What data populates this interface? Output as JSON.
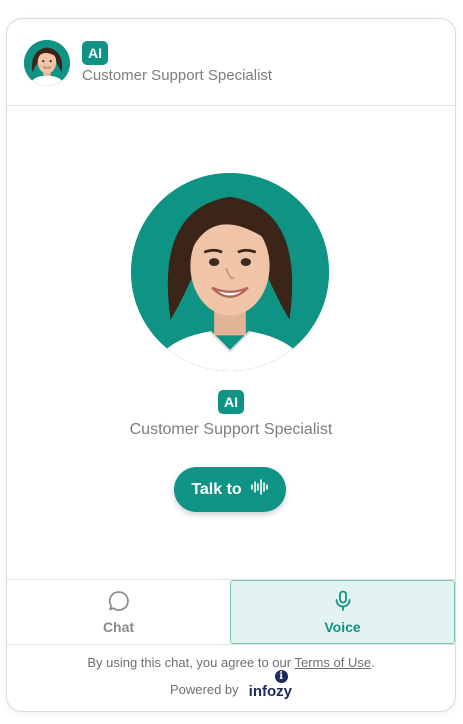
{
  "agent": {
    "badge": "AI",
    "role": "Customer Support Specialist"
  },
  "talk_button": {
    "label": "Talk to",
    "icon": "waveform-icon"
  },
  "tabs": [
    {
      "label": "Chat",
      "icon": "chat-bubble-icon",
      "active": false
    },
    {
      "label": "Voice",
      "icon": "microphone-icon",
      "active": true
    }
  ],
  "footer": {
    "terms_prefix": "By using this chat, you agree to our ",
    "terms_link": "Terms of Use",
    "terms_suffix": ".",
    "powered_by": "Powered by",
    "brand": "infozy"
  },
  "colors": {
    "accent": "#0e9384",
    "active_tab_bg": "#e4f3f1",
    "muted_text": "#7d7d7d"
  }
}
